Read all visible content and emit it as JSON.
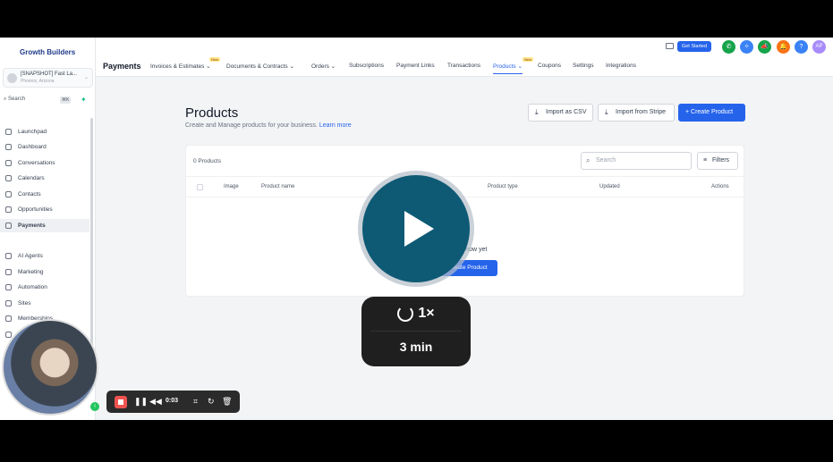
{
  "brand": {
    "name": "Growth Builders"
  },
  "account": {
    "name": "[SNAPSHOT] Fast La...",
    "location": "Phoenix, Arizona"
  },
  "sidebar": {
    "search_label": "Search",
    "search_shortcut": "⌘K",
    "items": [
      {
        "label": "Launchpad",
        "icon": "rocket-icon"
      },
      {
        "label": "Dashboard",
        "icon": "dashboard-icon"
      },
      {
        "label": "Conversations",
        "icon": "chat-icon"
      },
      {
        "label": "Calendars",
        "icon": "calendar-icon"
      },
      {
        "label": "Contacts",
        "icon": "contacts-icon"
      },
      {
        "label": "Opportunities",
        "icon": "funnel-icon"
      },
      {
        "label": "Payments",
        "icon": "payments-icon",
        "active": true
      },
      {
        "label": "AI Agents",
        "icon": "ai-icon"
      },
      {
        "label": "Marketing",
        "icon": "send-icon"
      },
      {
        "label": "Automation",
        "icon": "automation-icon"
      },
      {
        "label": "Sites",
        "icon": "sites-icon"
      },
      {
        "label": "Memberships",
        "icon": "memberships-icon"
      },
      {
        "label": "M",
        "icon": "media-icon"
      }
    ]
  },
  "topbar": {
    "section": "Payments",
    "tabs": [
      {
        "label": "Invoices & Estimates",
        "dropdown": true,
        "badge": "New"
      },
      {
        "label": "Documents & Contracts",
        "dropdown": true
      },
      {
        "label": "Orders",
        "dropdown": true
      },
      {
        "label": "Subscriptions"
      },
      {
        "label": "Payment Links"
      },
      {
        "label": "Transactions"
      },
      {
        "label": "Products",
        "dropdown": true,
        "badge": "New",
        "active": true
      },
      {
        "label": "Coupons"
      },
      {
        "label": "Settings"
      },
      {
        "label": "Integrations"
      }
    ],
    "get_started": "Get Started",
    "avatar_initials": "AP",
    "colors": {
      "phone": "#16a34a",
      "help": "#3b82f6",
      "megaphone": "#16a34a",
      "bell": "#f97316",
      "avatar": "#a78bfa"
    }
  },
  "products": {
    "title": "Products",
    "subtitle": "Create and Manage products for your business.",
    "learn_more": "Learn more",
    "import_csv": "Import as CSV",
    "import_stripe": "Import from Stripe",
    "create": "+ Create Product",
    "count": "0 Products",
    "search_placeholder": "Search",
    "filters": "Filters",
    "columns": [
      "Image",
      "Product name",
      "Product type",
      "Updated",
      "Actions"
    ],
    "empty_text": "cts to show yet",
    "empty_cta": "+ Create Product"
  },
  "player": {
    "speed": "1×",
    "duration": "3 min"
  },
  "recorder": {
    "time": "0:03"
  }
}
